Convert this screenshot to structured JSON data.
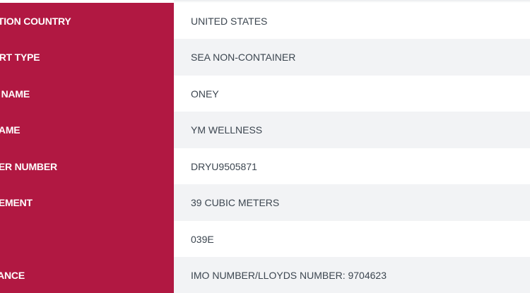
{
  "details": {
    "rows": [
      {
        "label": "ATION COUNTRY",
        "value": "UNITED STATES"
      },
      {
        "label": "ORT TYPE",
        "value": "SEA NON-CONTAINER"
      },
      {
        "label": "R NAME",
        "value": "ONEY"
      },
      {
        "label": "NAME",
        "value": "YM WELLNESS"
      },
      {
        "label": "NER NUMBER",
        "value": "DRYU9505871"
      },
      {
        "label": "REMENT",
        "value": "39 CUBIC METERS"
      },
      {
        "label": "",
        "value": "039E"
      },
      {
        "label": "VANCE",
        "value": "IMO NUMBER/LLOYDS NUMBER: 9704623"
      }
    ]
  },
  "colors": {
    "label_background": "#b11842",
    "row_alt_background": "#f2f3f5",
    "value_text": "#3c4650"
  }
}
